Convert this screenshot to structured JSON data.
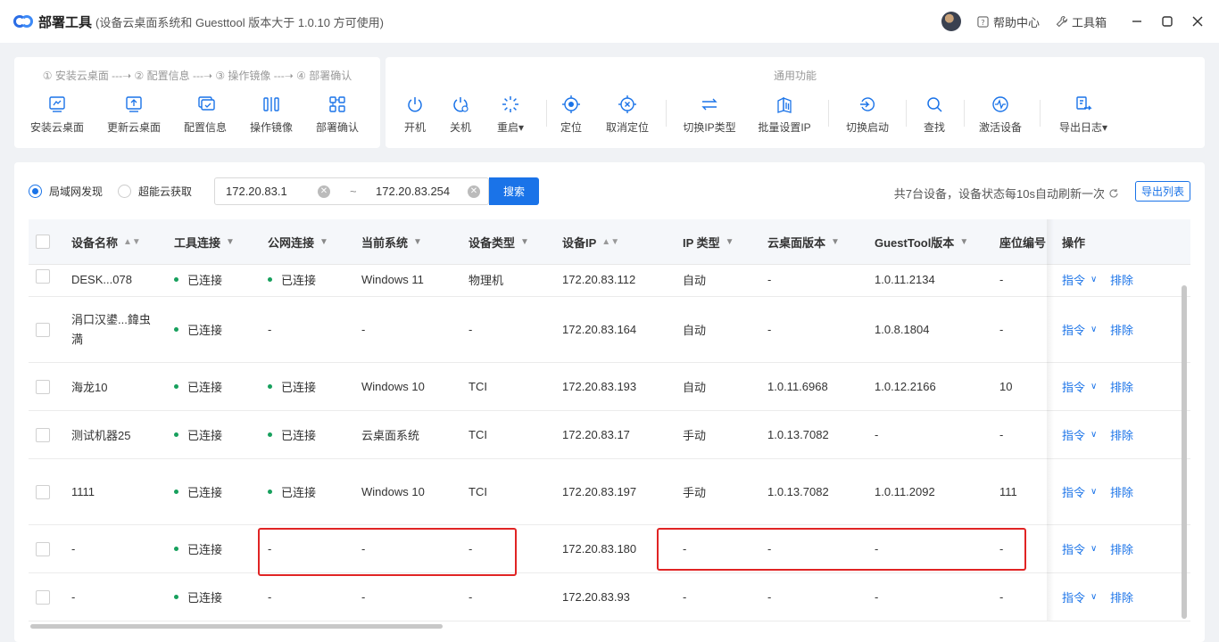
{
  "app": {
    "title": "部署工具",
    "subtitle": "(设备云桌面系统和 Guesttool 版本大于 1.0.10 方可使用)",
    "help": "帮助中心",
    "toolbox": "工具箱"
  },
  "deploy": {
    "steps": "① 安装云桌面 ---➝ ② 配置信息 ---➝ ③ 操作镜像 ---➝ ④ 部署确认",
    "tools": [
      {
        "label": "安装云桌面",
        "icon": "install-desktop-icon"
      },
      {
        "label": "更新云桌面",
        "icon": "update-desktop-icon"
      },
      {
        "label": "配置信息",
        "icon": "config-icon"
      },
      {
        "label": "操作镜像",
        "icon": "image-icon"
      },
      {
        "label": "部署确认",
        "icon": "deploy-confirm-icon"
      }
    ]
  },
  "general": {
    "title": "通用功能",
    "tools": [
      {
        "label": "开机"
      },
      {
        "label": "关机"
      },
      {
        "label": "重启▾"
      },
      {
        "label": "定位"
      },
      {
        "label": "取消定位"
      },
      {
        "label": "切换IP类型"
      },
      {
        "label": "批量设置IP"
      },
      {
        "label": "切换启动"
      },
      {
        "label": "查找"
      },
      {
        "label": "激活设备"
      },
      {
        "label": "导出日志▾"
      }
    ]
  },
  "filter": {
    "radio_lan": "局域网发现",
    "radio_cloud": "超能云获取",
    "ip_start": "172.20.83.1",
    "ip_sep": "~",
    "ip_end": "172.20.83.254",
    "search": "搜索",
    "info": "共7台设备，设备状态每10s自动刷新一次",
    "export": "导出列表"
  },
  "table": {
    "headers": [
      "设备名称",
      "工具连接",
      "公网连接",
      "当前系统",
      "设备类型",
      "设备IP",
      "IP 类型",
      "云桌面版本",
      "GuestTool版本",
      "座位编号",
      "操作"
    ],
    "rows": [
      {
        "name": "DESK...078",
        "tool": "已连接",
        "net": "已连接",
        "sys": "Windows 11",
        "type": "物理机",
        "ip": "172.20.83.112",
        "iptype": "自动",
        "ver": "-",
        "gt": "1.0.11.2134",
        "seat": "-",
        "cmd": "指令",
        "del": "排除"
      },
      {
        "name": "涓口汉鍙...鍏虫満",
        "tool": "已连接",
        "net": "-",
        "sys": "-",
        "type": "-",
        "ip": "172.20.83.164",
        "iptype": "自动",
        "ver": "-",
        "gt": "1.0.8.1804",
        "seat": "-",
        "cmd": "指令",
        "del": "排除"
      },
      {
        "name": "海龙10",
        "tool": "已连接",
        "net": "已连接",
        "sys": "Windows 10",
        "type": "TCI",
        "ip": "172.20.83.193",
        "iptype": "自动",
        "ver": "1.0.11.6968",
        "gt": "1.0.12.2166",
        "seat": "10",
        "cmd": "指令",
        "del": "排除"
      },
      {
        "name": "测试机器25",
        "tool": "已连接",
        "net": "已连接",
        "sys": "云桌面系统",
        "type": "TCI",
        "ip": "172.20.83.17",
        "iptype": "手动",
        "ver": "1.0.13.7082",
        "gt": "-",
        "seat": "-",
        "cmd": "指令",
        "del": "排除"
      },
      {
        "name": "1111",
        "tool": "已连接",
        "net": "已连接",
        "sys": "Windows 10",
        "type": "TCI",
        "ip": "172.20.83.197",
        "iptype": "手动",
        "ver": "1.0.13.7082",
        "gt": "1.0.11.2092",
        "seat": "111",
        "cmd": "指令",
        "del": "排除"
      },
      {
        "name": "-",
        "tool": "已连接",
        "net": "-",
        "sys": "-",
        "type": "-",
        "ip": "172.20.83.180",
        "iptype": "-",
        "ver": "-",
        "gt": "-",
        "seat": "-",
        "cmd": "指令",
        "del": "排除"
      },
      {
        "name": "-",
        "tool": "已连接",
        "net": "-",
        "sys": "-",
        "type": "-",
        "ip": "172.20.83.93",
        "iptype": "-",
        "ver": "-",
        "gt": "-",
        "seat": "-",
        "cmd": "指令",
        "del": "排除"
      }
    ]
  },
  "colors": {
    "accent": "#1a73e8",
    "connected": "#17a05d",
    "highlight": "#e02424"
  }
}
